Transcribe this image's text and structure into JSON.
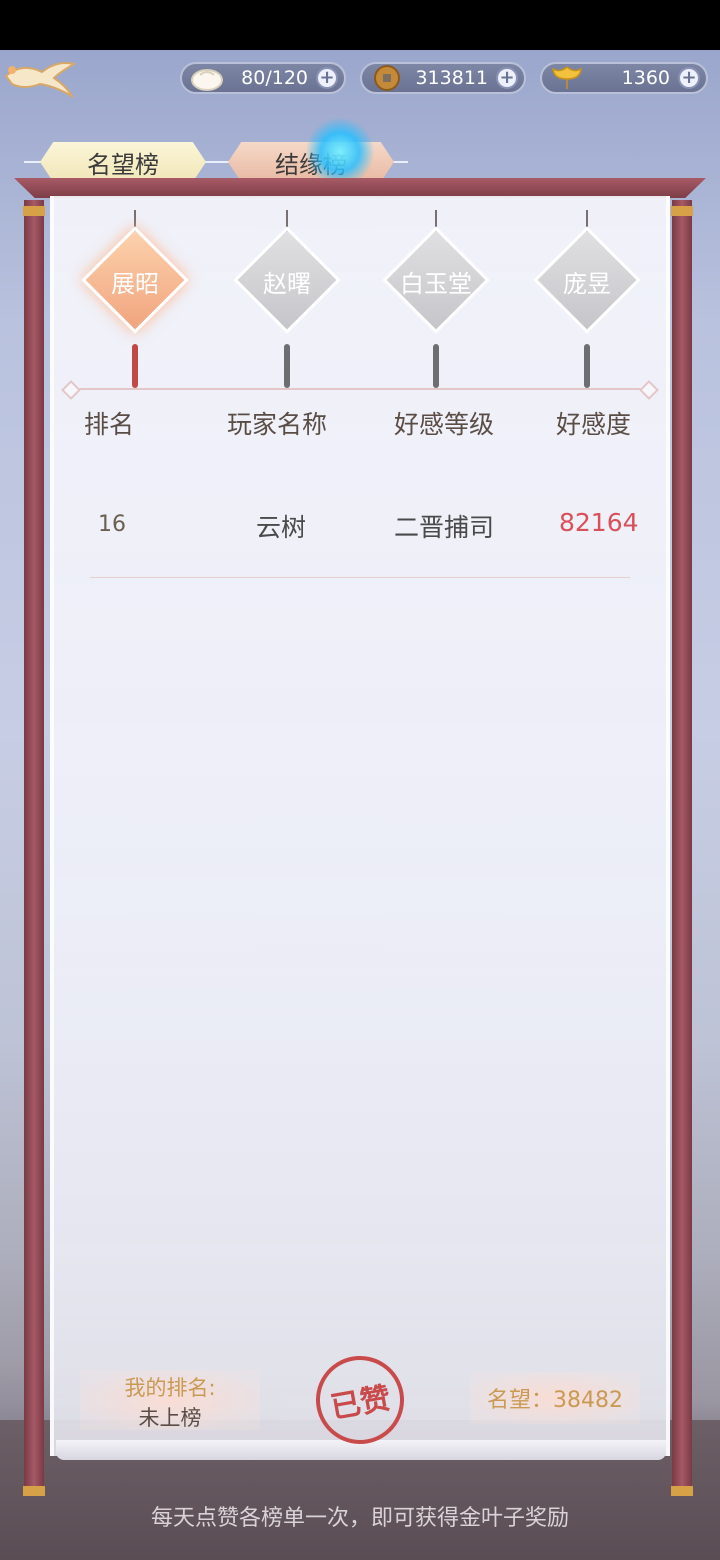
{
  "resources": [
    {
      "icon": "bun-icon",
      "value": "80/120"
    },
    {
      "icon": "copper-coin-icon",
      "value": "313811"
    },
    {
      "icon": "gold-leaf-icon",
      "value": "1360"
    }
  ],
  "tabs": [
    {
      "label": "名望榜"
    },
    {
      "label": "结缘榜"
    }
  ],
  "characters": [
    {
      "name": "展昭",
      "active": true
    },
    {
      "name": "赵曙",
      "active": false
    },
    {
      "name": "白玉堂",
      "active": false
    },
    {
      "name": "庞昱",
      "active": false
    }
  ],
  "table": {
    "headers": [
      "排名",
      "玩家名称",
      "好感等级",
      "好感度"
    ],
    "rows": [
      {
        "rank": "16",
        "player": "云树",
        "level": "二晋捕司",
        "affinity": "82164"
      }
    ]
  },
  "footer": {
    "my_rank_label": "我的排名:",
    "my_rank_value": "未上榜",
    "liked_stamp": "已赞",
    "fame_text": "名望：38482",
    "tip": "每天点赞各榜单一次，即可获得金叶子奖励"
  },
  "colors": {
    "frame": "#a55966",
    "accent_red": "#d9505a",
    "gold_text": "#c99a54"
  }
}
